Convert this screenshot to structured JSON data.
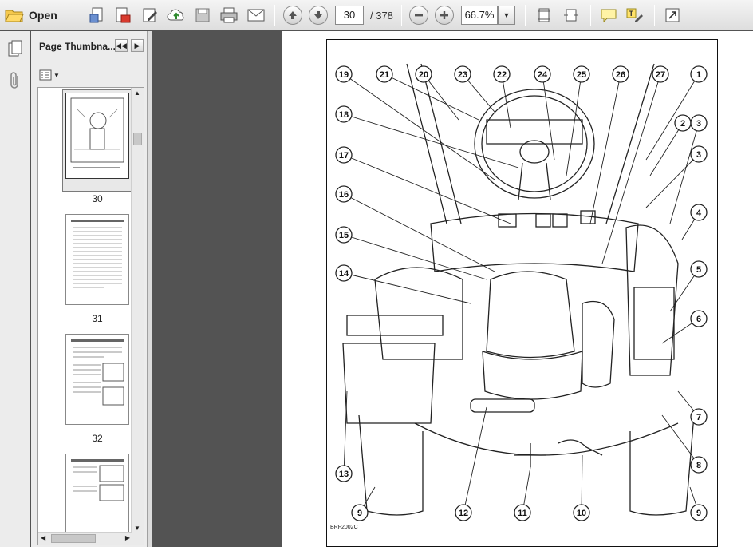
{
  "toolbar": {
    "open_label": "Open",
    "current_page": "30",
    "page_total": "/ 378",
    "zoom_value": "66.7%",
    "icons": [
      "open-folder-icon",
      "print-setup-icon",
      "pdf-create-icon",
      "edit-icon",
      "cloud-upload-icon",
      "save-icon",
      "print-icon",
      "email-icon",
      "prev-page-icon",
      "next-page-icon",
      "zoom-out-icon",
      "zoom-in-icon",
      "fit-page-icon",
      "fit-width-icon",
      "comment-icon",
      "highlight-icon",
      "fullscreen-icon"
    ]
  },
  "sidebar": {
    "title": "Page Thumbna...",
    "thumbnails": [
      {
        "label": "30"
      },
      {
        "label": "31"
      },
      {
        "label": "32"
      }
    ]
  },
  "diagram": {
    "figure_code": "BRF2002C",
    "callouts": [
      "1",
      "2",
      "3",
      "3",
      "4",
      "5",
      "6",
      "7",
      "8",
      "9",
      "9",
      "10",
      "11",
      "12",
      "13",
      "14",
      "15",
      "16",
      "17",
      "18",
      "19",
      "20",
      "21",
      "22",
      "23",
      "24",
      "25",
      "26",
      "27"
    ]
  }
}
